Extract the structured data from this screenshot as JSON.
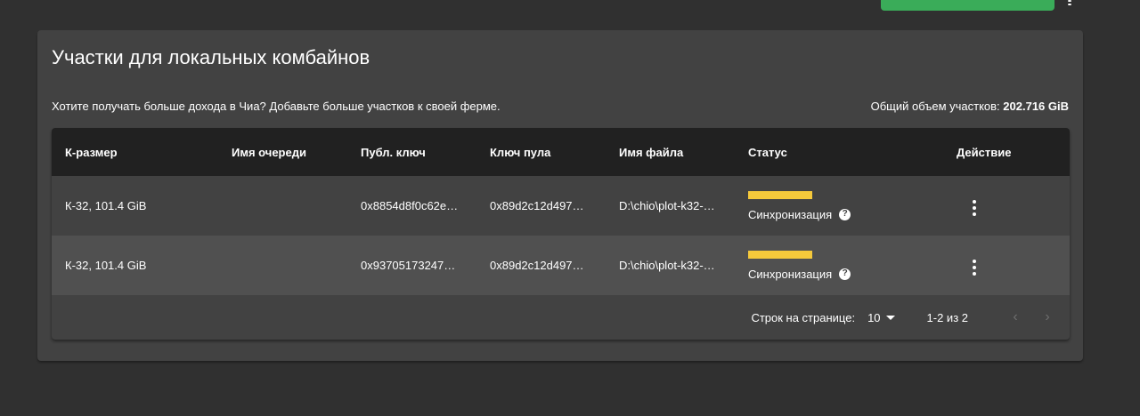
{
  "card": {
    "title": "Участки для локальных комбайнов",
    "description": "Хотите получать больше дохода в Чиа? Добавьте больше участков к своей ферме.",
    "total_label": "Общий объем участков:",
    "total_value": "202.716 GiB"
  },
  "table": {
    "columns": [
      "К-размер",
      "Имя очереди",
      "Публ. ключ",
      "Ключ пула",
      "Имя файла",
      "Статус",
      "Действие"
    ],
    "rows": [
      {
        "size": "К-32, 101.4 GiB",
        "queue": "",
        "pub_key": "0x8854d8f0c62e…",
        "pool_key": "0x89d2c12d497…",
        "file": "D:\\chio\\plot-k32-…",
        "status": "Синхронизация"
      },
      {
        "size": "К-32, 101.4 GiB",
        "queue": "",
        "pub_key": "0x93705173247…",
        "pool_key": "0x89d2c12d497…",
        "file": "D:\\chio\\plot-k32-…",
        "status": "Синхронизация"
      }
    ],
    "help_glyph": "?"
  },
  "pagination": {
    "rows_per_page_label": "Строк на странице:",
    "rows_per_page_value": "10",
    "range": "1-2 из 2",
    "prev_glyph": "‹",
    "next_glyph": "›"
  },
  "colors": {
    "background": "#303030",
    "card": "#424242",
    "table_header": "#212121",
    "status_bar": "#f5c93b",
    "top_button": "#3aac59"
  },
  "icons": {
    "menu": "more-vert-icon",
    "help": "help-icon",
    "prev": "chevron-left-icon",
    "next": "chevron-right-icon",
    "dropdown": "caret-down-icon"
  }
}
